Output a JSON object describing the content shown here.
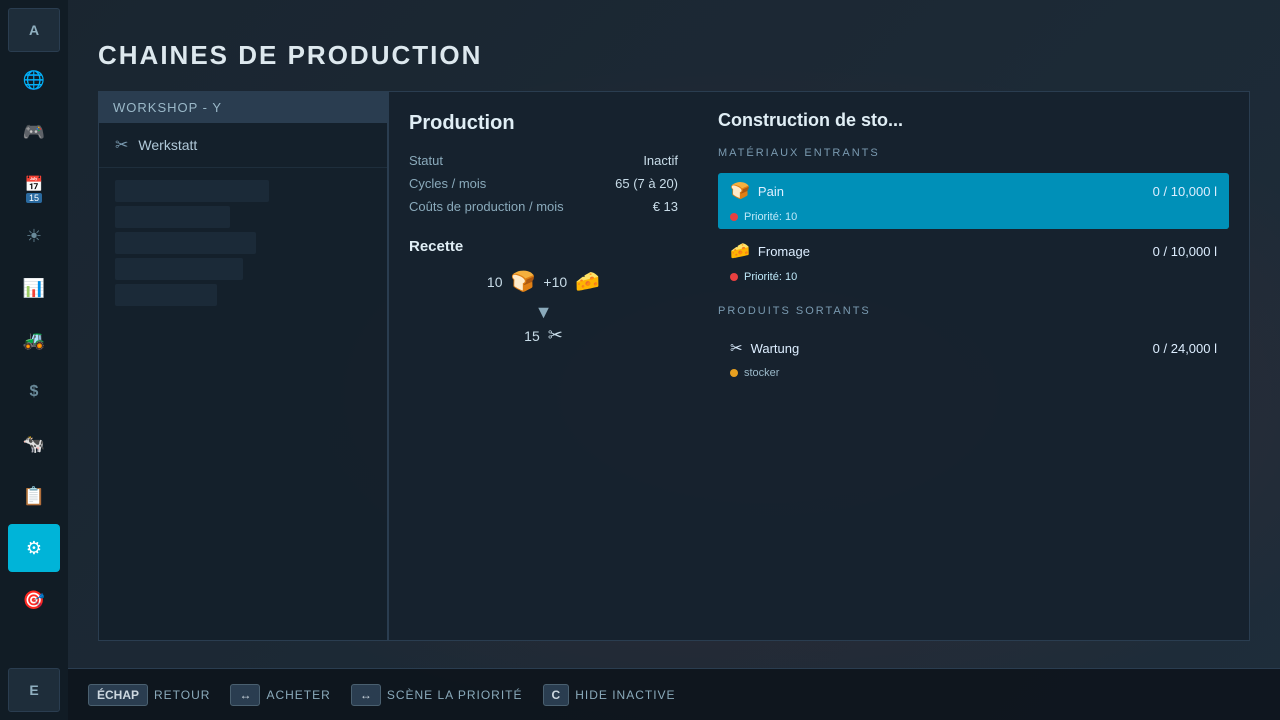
{
  "page": {
    "title": "CHAINES DE PRODUCTION",
    "bg_text": "WorKSHOP"
  },
  "sidebar": {
    "items": [
      {
        "id": "a-key",
        "label": "A",
        "icon": "A",
        "active": false,
        "top": true
      },
      {
        "id": "globe",
        "label": "Globe",
        "icon": "🌐",
        "active": false
      },
      {
        "id": "steering",
        "label": "Steering",
        "icon": "🎮",
        "active": false
      },
      {
        "id": "calendar",
        "label": "Calendar",
        "icon": "📅",
        "active": false
      },
      {
        "id": "sun",
        "label": "Sun",
        "icon": "☀",
        "active": false
      },
      {
        "id": "chart",
        "label": "Chart",
        "icon": "📊",
        "active": false
      },
      {
        "id": "tractor",
        "label": "Tractor",
        "icon": "🚜",
        "active": false
      },
      {
        "id": "dollar",
        "label": "Dollar",
        "icon": "$",
        "active": false
      },
      {
        "id": "animal",
        "label": "Animal",
        "icon": "🐄",
        "active": false
      },
      {
        "id": "contracts",
        "label": "Contracts",
        "icon": "📋",
        "active": false
      },
      {
        "id": "production",
        "label": "Production",
        "icon": "⚙",
        "active": true
      },
      {
        "id": "misc",
        "label": "Misc",
        "icon": "🎯",
        "active": false
      },
      {
        "id": "e-key",
        "label": "E",
        "icon": "E",
        "active": false,
        "bottom": true
      }
    ]
  },
  "workshop": {
    "header_text": "WORKSHOP  -  Y",
    "items": [
      {
        "name": "Werkstatt",
        "icon": "wrench"
      }
    ]
  },
  "production": {
    "title": "Production",
    "statut_label": "Statut",
    "statut_value": "Inactif",
    "cycles_label": "Cycles / mois",
    "cycles_value": "65 (7 à 20)",
    "couts_label": "Coûts de production / mois",
    "couts_value": "€ 13",
    "recette_label": "Recette",
    "recipe_qty1": "10",
    "recipe_icon1": "🍞",
    "recipe_plus": "+10",
    "recipe_icon2": "🧀",
    "recipe_arrow": "▼",
    "recipe_qty2": "15",
    "recipe_icon3": "✂"
  },
  "construction": {
    "title": "Construction de sto...",
    "materiaux_label": "MATÉRIAUX ENTRANTS",
    "materials": [
      {
        "name": "Pain",
        "icon": "🍞",
        "amount": "0  /  10,000 l",
        "priority": "Priorité: 10",
        "priority_color": "#e84040",
        "selected": true
      },
      {
        "name": "Fromage",
        "icon": "🧀",
        "amount": "0  /  10,000 l",
        "priority": "Priorité: 10",
        "priority_color": "#e84040",
        "selected": false
      }
    ],
    "produits_label": "PRODUITS SORTANTS",
    "products": [
      {
        "name": "Wartung",
        "icon": "✂",
        "amount": "0  /  24,000 l",
        "store_label": "stocker",
        "dot_color": "#e8a020"
      }
    ]
  },
  "bottombar": {
    "buttons": [
      {
        "key": "ÉCHAP",
        "label": "RETOUR"
      },
      {
        "key": "↔",
        "label": "ACHETER"
      },
      {
        "key": "↔",
        "label": "SCÈNE LA PRIORITÉ"
      },
      {
        "key": "C",
        "label": "HIDE INACTIVE"
      }
    ]
  }
}
